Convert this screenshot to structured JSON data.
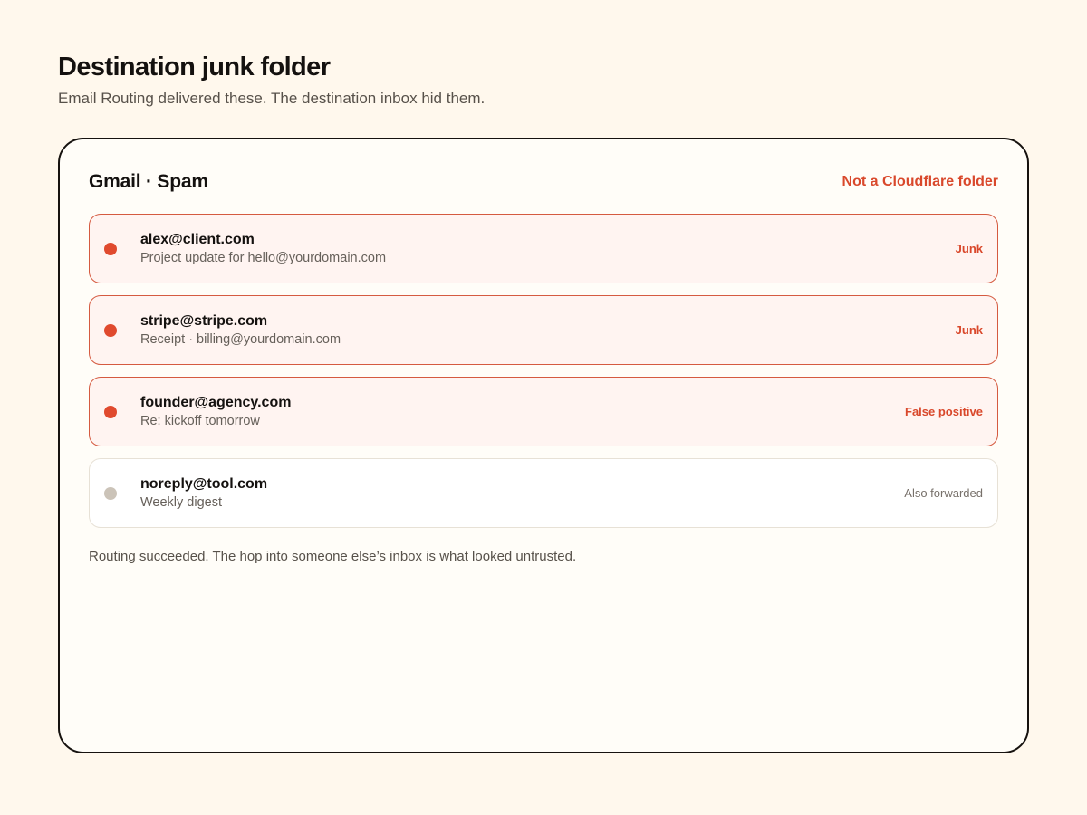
{
  "header": {
    "title": "Destination junk folder",
    "subtitle": "Email Routing delivered these. The destination inbox hid them."
  },
  "panel": {
    "title": "Gmail · Spam",
    "flag": "Not a Cloudflare folder",
    "footer": "Routing succeeded. The hop into someone else’s inbox is what looked untrusted."
  },
  "messages": [
    {
      "sender": "alex@client.com",
      "subject": "Project update for hello@yourdomain.com",
      "tag": "Junk",
      "flagged": true
    },
    {
      "sender": "stripe@stripe.com",
      "subject": "Receipt · billing@yourdomain.com",
      "tag": "Junk",
      "flagged": true
    },
    {
      "sender": "founder@agency.com",
      "subject": "Re: kickoff tomorrow",
      "tag": "False positive",
      "flagged": true
    },
    {
      "sender": "noreply@tool.com",
      "subject": "Weekly digest",
      "tag": "Also forwarded",
      "flagged": false
    }
  ],
  "colors": {
    "background": "#fff8ed",
    "accent_red": "#d9482b",
    "flagged_row_bg": "#fff4f1",
    "neutral_dot": "#cbc3b8"
  }
}
